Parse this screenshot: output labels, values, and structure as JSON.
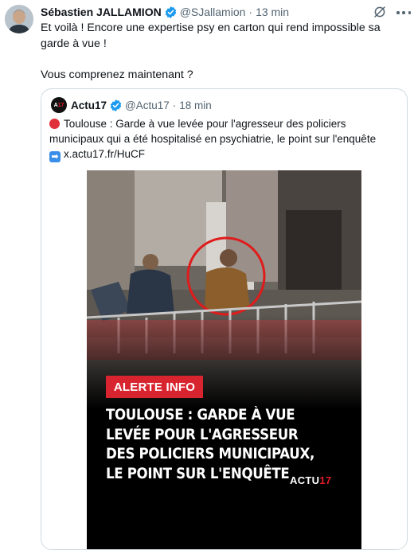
{
  "author": {
    "name": "Sébastien JALLAMION",
    "handle": "@SJallamion",
    "separator": "·",
    "time": "13 min"
  },
  "tweet": {
    "line1": "Et voilà ! Encore une expertise psy en carton qui rend impossible sa garde à vue !",
    "line2": "Vous comprenez maintenant ?"
  },
  "quote": {
    "avatar_text_a": "A",
    "avatar_text_b": "17",
    "name": "Actu17",
    "handle": "@Actu17",
    "separator": "·",
    "time": "18 min",
    "text": "Toulouse : Garde à vue levée pour l'agresseur des policiers municipaux qui a été hospitalisé en psychiatrie, le point sur l'enquête",
    "link": "x.actu17.fr/HuCF",
    "arrow": "➡"
  },
  "media": {
    "badge": "ALERTE INFO",
    "headline": [
      "TOULOUSE : GARDE À VUE",
      "LEVÉE POUR L'AGRESSEUR",
      "DES POLICIERS MUNICIPAUX,",
      "LE POINT SUR L'ENQUÊTE"
    ],
    "brand_a": "ACTU",
    "brand_b": "17"
  },
  "colors": {
    "verified": "#1d9bf0",
    "alert_red": "#d8242f",
    "muted": "#536471"
  }
}
